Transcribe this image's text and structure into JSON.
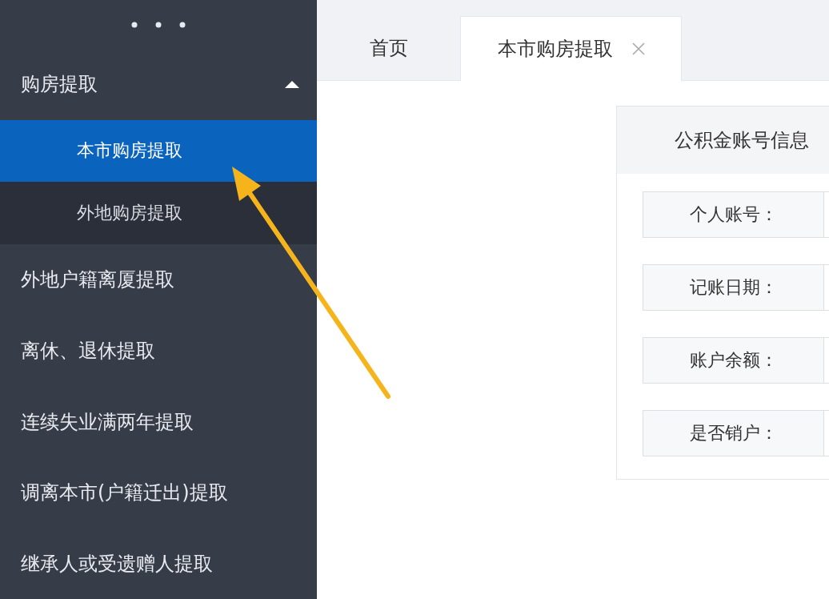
{
  "sidebar": {
    "items": [
      {
        "label": "购房提取",
        "kind": "group",
        "expanded": true,
        "children": [
          {
            "label": "本市购房提取",
            "selected": true
          },
          {
            "label": "外地购房提取",
            "selected": false
          }
        ]
      },
      {
        "label": "外地户籍离厦提取",
        "kind": "item"
      },
      {
        "label": "离休、退休提取",
        "kind": "item"
      },
      {
        "label": "连续失业满两年提取",
        "kind": "item"
      },
      {
        "label": "调离本市(户籍迁出)提取",
        "kind": "item"
      },
      {
        "label": "继承人或受遗赠人提取",
        "kind": "item"
      }
    ]
  },
  "tabs": [
    {
      "label": "首页",
      "selected": false,
      "closable": false
    },
    {
      "label": "本市购房提取",
      "selected": true,
      "closable": true
    }
  ],
  "card": {
    "title": "公积金账号信息",
    "fields": [
      {
        "label": "个人账号："
      },
      {
        "label": "记账日期："
      },
      {
        "label": "账户余额："
      },
      {
        "label": "是否销户："
      }
    ]
  }
}
